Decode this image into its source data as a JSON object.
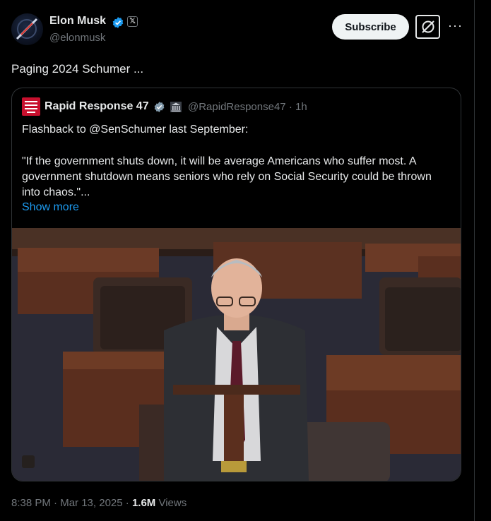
{
  "post": {
    "author_name": "Elon Musk",
    "author_handle": "@elonmusk",
    "subscribe_label": "Subscribe",
    "more_label": "···",
    "x_badge": "𝕏",
    "text": "Paging 2024 Schumer ...",
    "time": "8:38 PM",
    "sep1": "·",
    "date": "Mar 13, 2025",
    "sep2": "·",
    "views_count": "1.6M",
    "views_label": "Views"
  },
  "quote": {
    "author_name": "Rapid Response 47",
    "author_handle": "@RapidResponse47",
    "time_ago": "· 1h",
    "line1": "Flashback to @SenSchumer last September:",
    "body": "\"If the government shuts down, it will be average Americans who suffer most. A government shutdown means seniors who rely on Social Security could be thrown into chaos.\"...",
    "show_more": "Show more"
  },
  "icons": {
    "verified": "verified-badge-icon",
    "grok": "grok-icon",
    "more": "more-dots-icon",
    "gov": "government-building-icon"
  },
  "colors": {
    "verified_blue": "#1d9bf0",
    "link_blue": "#1d9bf0",
    "muted": "#71767b",
    "text": "#e7e9ea",
    "subscribe_bg": "#eff3f4"
  }
}
